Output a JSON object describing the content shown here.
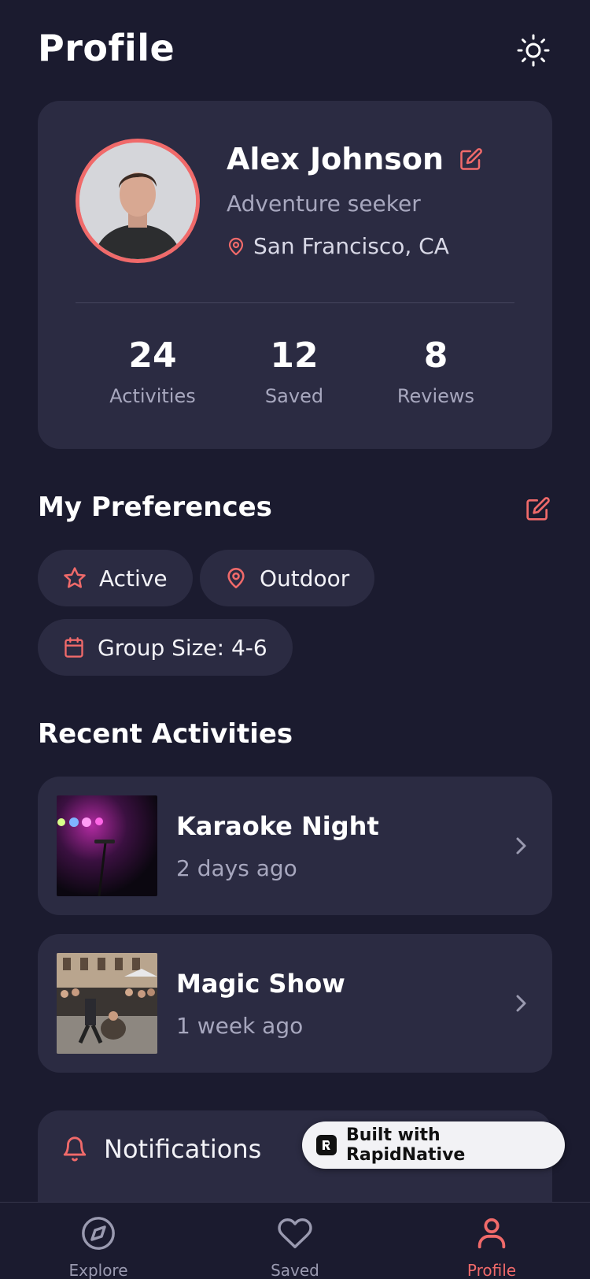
{
  "header": {
    "title": "Profile"
  },
  "profile": {
    "name": "Alex Johnson",
    "tagline": "Adventure seeker",
    "location": "San Francisco, CA",
    "stats": [
      {
        "value": "24",
        "label": "Activities"
      },
      {
        "value": "12",
        "label": "Saved"
      },
      {
        "value": "8",
        "label": "Reviews"
      }
    ]
  },
  "preferences": {
    "title": "My Preferences",
    "chips": [
      {
        "label": "Active",
        "icon": "star-icon"
      },
      {
        "label": "Outdoor",
        "icon": "map-pin-icon"
      },
      {
        "label": "Group Size: 4-6",
        "icon": "calendar-icon"
      }
    ]
  },
  "recent": {
    "title": "Recent Activities",
    "items": [
      {
        "title": "Karaoke Night",
        "time": "2 days ago"
      },
      {
        "title": "Magic Show",
        "time": "1 week ago"
      }
    ]
  },
  "settings": {
    "notifications_label": "Notifications"
  },
  "badge": {
    "text": "Built with RapidNative"
  },
  "tabs": [
    {
      "label": "Explore",
      "icon": "compass-icon"
    },
    {
      "label": "Saved",
      "icon": "heart-icon"
    },
    {
      "label": "Profile",
      "icon": "user-icon",
      "active": true
    }
  ],
  "colors": {
    "background": "#1b1b2f",
    "card": "#2b2b42",
    "accent": "#f06a6a",
    "muted": "#a7a7be"
  }
}
